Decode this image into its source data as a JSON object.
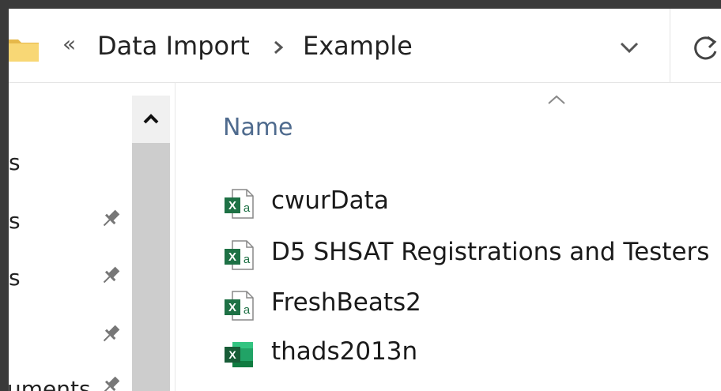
{
  "address_bar": {
    "overflow_chevron": "«",
    "breadcrumbs": [
      "Data Import",
      "Example"
    ],
    "folder_icon": "folder-icon",
    "dropdown_icon": "chevron-down-icon",
    "refresh_icon": "refresh-icon"
  },
  "nav_pane": {
    "items": [
      {
        "label": "s",
        "pinned": false
      },
      {
        "label": "s",
        "pinned": true
      },
      {
        "label": "s",
        "pinned": true
      },
      {
        "label": "",
        "pinned": true
      },
      {
        "label": "uments",
        "pinned": true
      }
    ],
    "pin_icon": "pin-icon",
    "scroll_up_icon": "chevron-up-icon"
  },
  "file_list": {
    "column_header": "Name",
    "sort_icon": "sort-up-caret-icon",
    "files": [
      {
        "name": "cwurData",
        "icon": "csv-excel-icon"
      },
      {
        "name": "D5 SHSAT Registrations and Testers",
        "icon": "csv-excel-icon"
      },
      {
        "name": "FreshBeats2",
        "icon": "csv-excel-icon"
      },
      {
        "name": "thads2013n",
        "icon": "excel-workbook-icon"
      }
    ]
  },
  "colors": {
    "header_text": "#4f6b8e",
    "excel_green": "#1e7145",
    "folder_yellow": "#f8d775",
    "scrollbar": "#cdcdcd"
  }
}
